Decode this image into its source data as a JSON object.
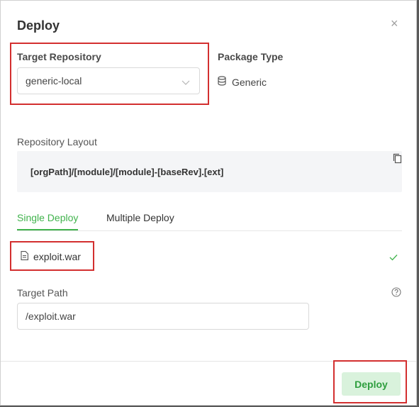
{
  "dialog": {
    "title": "Deploy",
    "close_icon": "×"
  },
  "target_repository": {
    "label": "Target Repository",
    "selected": "generic-local"
  },
  "package_type": {
    "label": "Package Type",
    "value": "Generic",
    "icon": "database-icon"
  },
  "repository_layout": {
    "label": "Repository Layout",
    "value": "[orgPath]/[module]/[module]-[baseRev].[ext]"
  },
  "tabs": [
    {
      "label": "Single Deploy",
      "active": true
    },
    {
      "label": "Multiple Deploy",
      "active": false
    }
  ],
  "file": {
    "name": "exploit.war",
    "status": "uploaded"
  },
  "target_path": {
    "label": "Target Path",
    "value": "/exploit.war"
  },
  "footer": {
    "deploy_label": "Deploy"
  },
  "colors": {
    "accent": "#40b34c",
    "highlight": "#d32f2f",
    "deploy_bg": "#d9f2dc"
  }
}
